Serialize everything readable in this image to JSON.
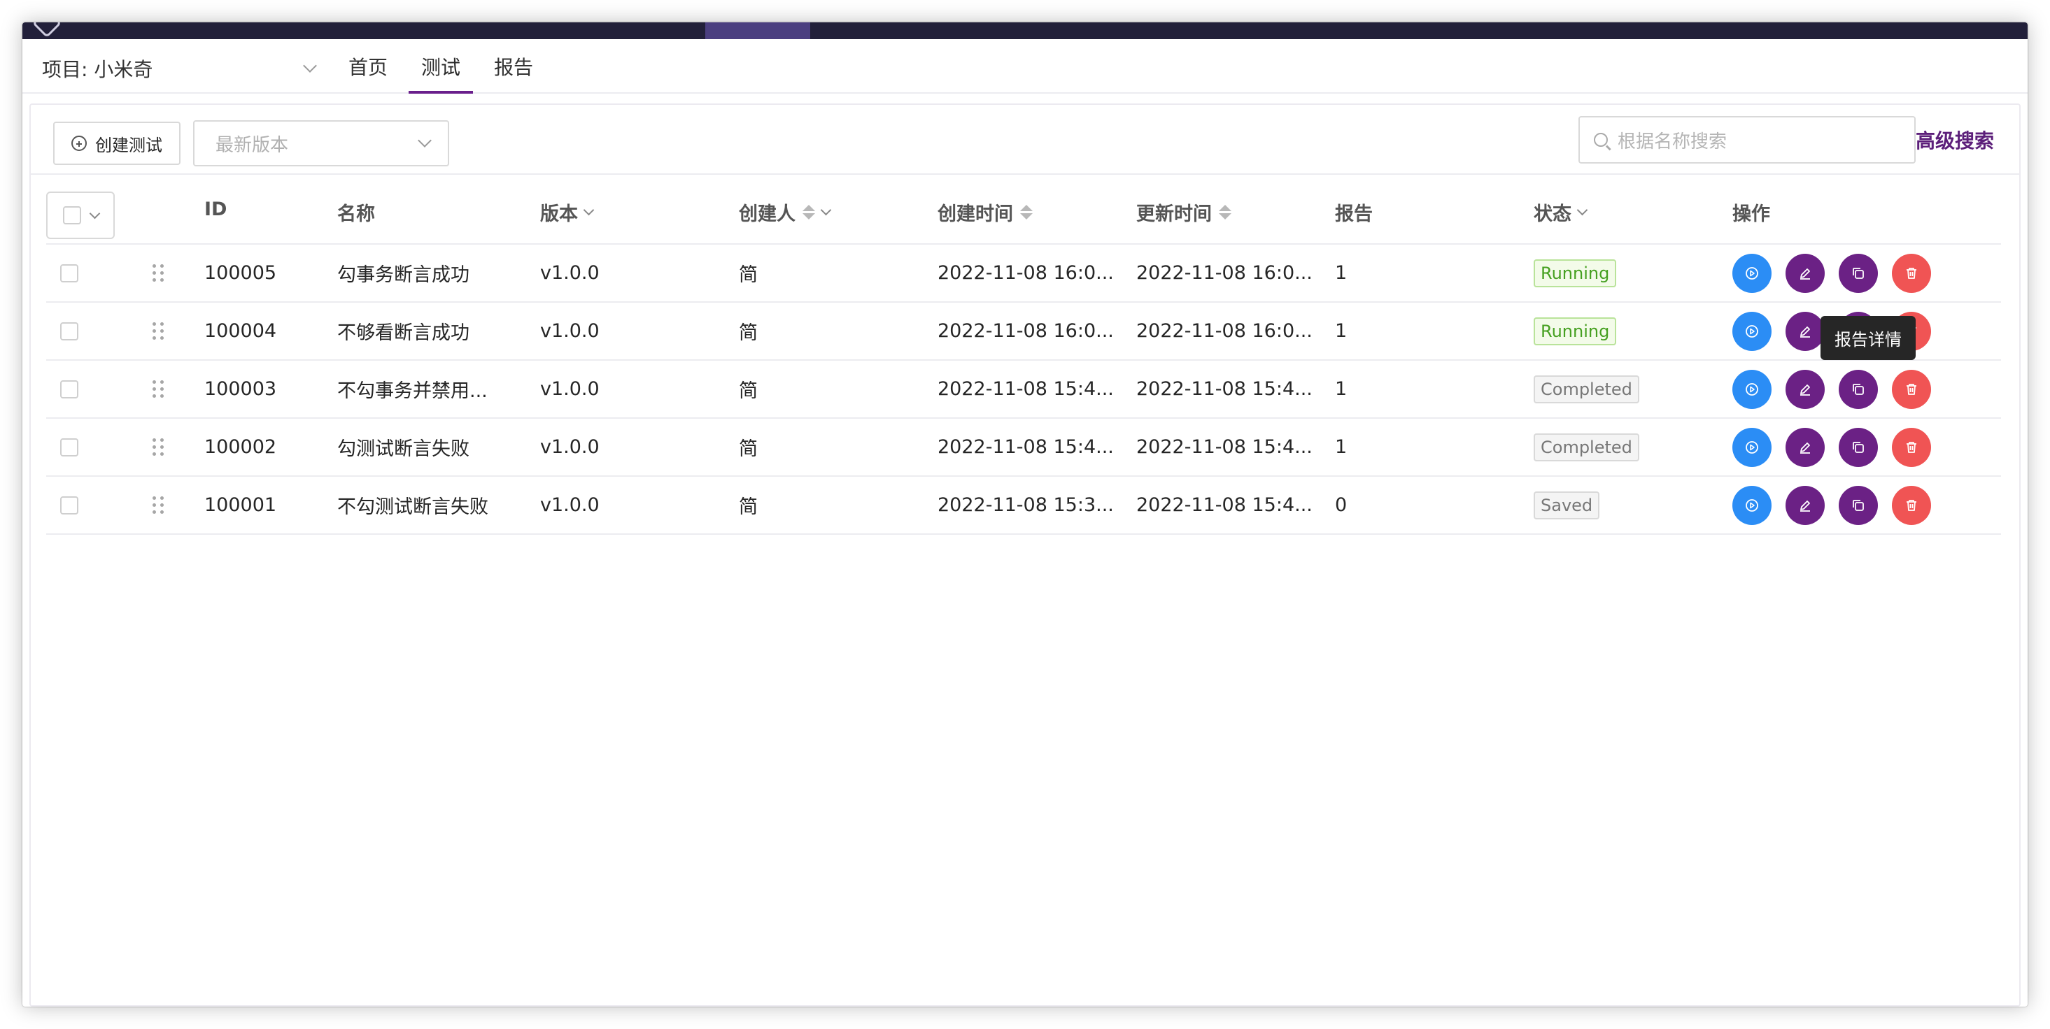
{
  "header": {
    "project_label": "项目: 小米奇",
    "tabs": [
      {
        "label": "首页",
        "active": false
      },
      {
        "label": "测试",
        "active": true
      },
      {
        "label": "报告",
        "active": false
      }
    ]
  },
  "toolbar": {
    "create_label": "创建测试",
    "version_placeholder": "最新版本",
    "search_placeholder": "根据名称搜索",
    "advanced_search_label": "高级搜索"
  },
  "table": {
    "columns": {
      "id": "ID",
      "name": "名称",
      "version": "版本",
      "creator": "创建人",
      "created_at": "创建时间",
      "updated_at": "更新时间",
      "reports": "报告",
      "status": "状态",
      "actions": "操作"
    },
    "rows": [
      {
        "id": "100005",
        "name": "勾事务断言成功",
        "version": "v1.0.0",
        "creator": "简",
        "created_at": "2022-11-08 16:0...",
        "updated_at": "2022-11-08 16:0...",
        "reports": "1",
        "status": "Running",
        "status_type": "running"
      },
      {
        "id": "100004",
        "name": "不够看断言成功",
        "version": "v1.0.0",
        "creator": "简",
        "created_at": "2022-11-08 16:0...",
        "updated_at": "2022-11-08 16:0...",
        "reports": "1",
        "status": "Running",
        "status_type": "running"
      },
      {
        "id": "100003",
        "name": "不勾事务并禁用...",
        "version": "v1.0.0",
        "creator": "简",
        "created_at": "2022-11-08 15:4...",
        "updated_at": "2022-11-08 15:4...",
        "reports": "1",
        "status": "Completed",
        "status_type": "completed"
      },
      {
        "id": "100002",
        "name": "勾测试断言失败",
        "version": "v1.0.0",
        "creator": "简",
        "created_at": "2022-11-08 15:4...",
        "updated_at": "2022-11-08 15:4...",
        "reports": "1",
        "status": "Completed",
        "status_type": "completed"
      },
      {
        "id": "100001",
        "name": "不勾测试断言失败",
        "version": "v1.0.0",
        "creator": "简",
        "created_at": "2022-11-08 15:3...",
        "updated_at": "2022-11-08 15:4...",
        "reports": "0",
        "status": "Saved",
        "status_type": "saved"
      }
    ]
  },
  "tooltip": {
    "text": "报告详情"
  },
  "colors": {
    "accent": "#6a1f8c",
    "run_button": "#2b8df5",
    "edit_button": "#6b2185",
    "delete_button": "#f05454",
    "running_text": "#46a021"
  },
  "icons": {
    "run": "play-circle-icon",
    "edit": "pencil-icon",
    "copy": "copy-icon",
    "delete": "trash-icon",
    "search": "search-icon",
    "create": "plus-circle-icon"
  }
}
